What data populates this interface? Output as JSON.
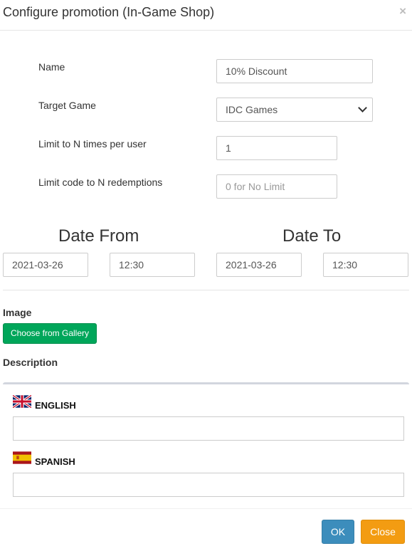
{
  "dialog": {
    "title": "Configure promotion (In-Game Shop)",
    "close_glyph": "×"
  },
  "form": {
    "name_label": "Name",
    "name_value": "10% Discount",
    "target_game_label": "Target Game",
    "target_game_value": "IDC Games",
    "limit_user_label": "Limit to N times per user",
    "limit_user_value": "1",
    "limit_code_label": "Limit code to N redemptions",
    "limit_code_placeholder": "0 for No Limit"
  },
  "dates": {
    "from_heading": "Date From",
    "from_date": "2021-03-26",
    "from_time": "12:30",
    "to_heading": "Date To",
    "to_date": "2021-03-26",
    "to_time": "12:30"
  },
  "image": {
    "heading": "Image",
    "gallery_button": "Choose from Gallery"
  },
  "description": {
    "heading": "Description",
    "languages": [
      {
        "label": "ENGLISH",
        "icon": "uk-flag-icon"
      },
      {
        "label": "SPANISH",
        "icon": "spain-flag-icon"
      }
    ]
  },
  "footer": {
    "ok_label": "OK",
    "close_label": "Close"
  },
  "colors": {
    "ok": "#3c8dbc",
    "close": "#f39c12",
    "gallery": "#00a65a"
  }
}
